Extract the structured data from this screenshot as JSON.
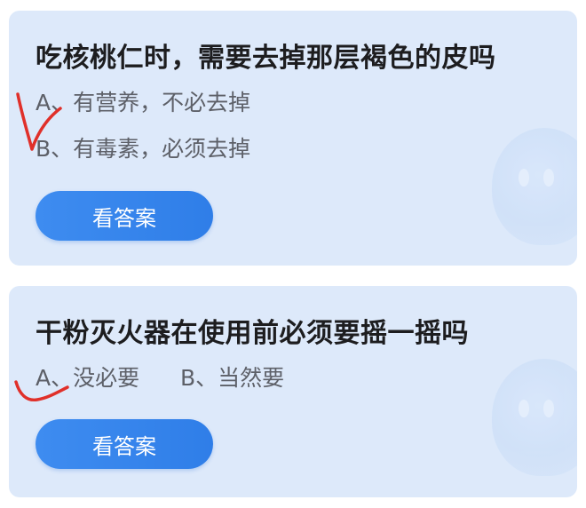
{
  "quiz": [
    {
      "question": "吃核桃仁时，需要去掉那层褐色的皮吗",
      "options": [
        "A、有营养，不必去掉",
        "B、有毒素，必须去掉"
      ],
      "button_label": "看答案"
    },
    {
      "question": "干粉灭火器在使用前必须要摇一摇吗",
      "options": [
        "A、没必要",
        "B、当然要"
      ],
      "button_label": "看答案"
    }
  ],
  "colors": {
    "card_background": "#dde9fa",
    "button": "#3584ec",
    "handwritten_mark": "#e0302a",
    "question_text": "#1d1d1f",
    "option_text": "#5d6068"
  },
  "icons": [
    "mascot-watermark-icon",
    "handwritten-check-mark"
  ]
}
